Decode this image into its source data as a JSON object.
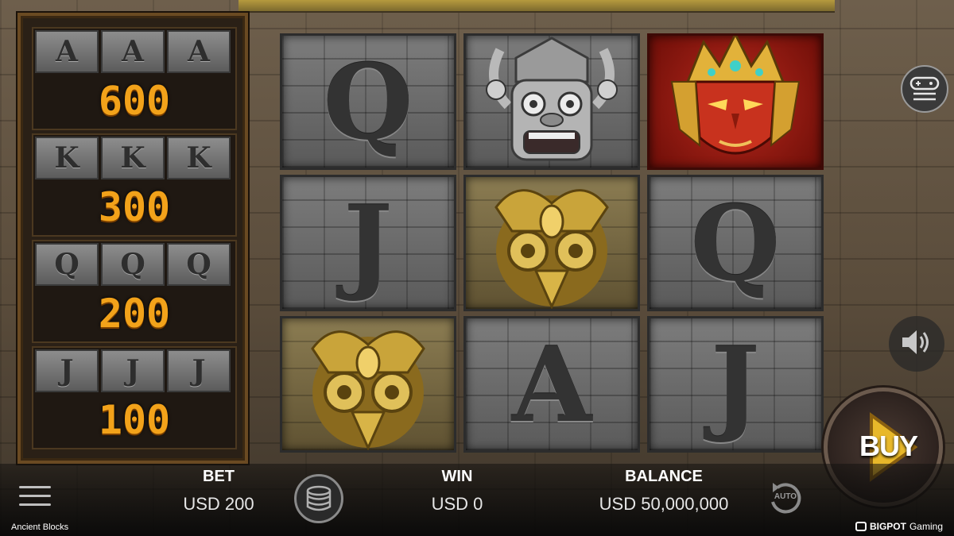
{
  "game": {
    "title": "Ancient Blocks",
    "brand_strong": "BIGPOT",
    "brand_light": "Gaming"
  },
  "paytable": [
    {
      "symbol": "A",
      "value": "600"
    },
    {
      "symbol": "K",
      "value": "300"
    },
    {
      "symbol": "Q",
      "value": "200"
    },
    {
      "symbol": "J",
      "value": "100"
    }
  ],
  "reels": [
    [
      {
        "type": "letter",
        "label": "Q"
      },
      {
        "type": "letter",
        "label": "J"
      },
      {
        "type": "icon",
        "icon": "gold-owl-icon"
      }
    ],
    [
      {
        "type": "icon",
        "icon": "stone-demon-mask-icon"
      },
      {
        "type": "icon",
        "icon": "gold-owl-icon"
      },
      {
        "type": "letter",
        "label": "A"
      }
    ],
    [
      {
        "type": "icon",
        "icon": "red-warrior-mask-icon"
      },
      {
        "type": "letter",
        "label": "Q"
      },
      {
        "type": "letter",
        "label": "J"
      }
    ]
  ],
  "controls": {
    "buy_label": "BUY",
    "bet_label": "BET",
    "bet_value": "USD 200",
    "win_label": "WIN",
    "win_value": "USD 0",
    "balance_label": "BALANCE",
    "balance_value": "USD 50,000,000",
    "auto_label": "AUTO"
  },
  "colors": {
    "paytable_value": "#f2a21a",
    "frame": "#6a4a22",
    "red_symbol": "#b8281c"
  }
}
